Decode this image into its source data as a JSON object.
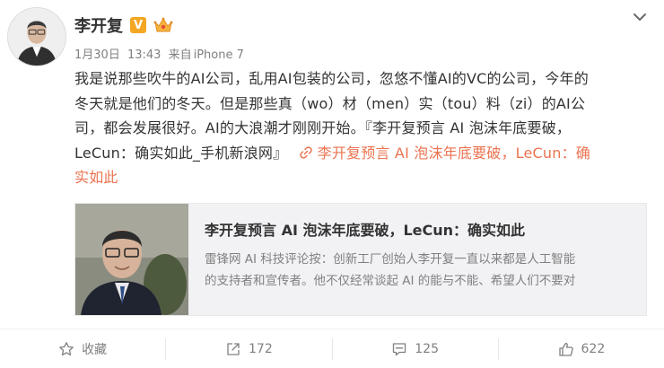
{
  "post": {
    "author": "李开复",
    "verified_badge": "V",
    "meta": {
      "date": "1月30日",
      "time": "13:43",
      "source_prefix": "来自",
      "source": "iPhone 7"
    },
    "content": {
      "line1": "我是说那些吹牛的AI公司，乱用AI包装的公司，忽悠不懂AI的VC的公司，今年的",
      "line2": "冬天就是他们的冬天。但是那些真（wo）材（men）实（tou）料（zi）的AI公",
      "line3": "司，都会发展很好。AI的大浪潮才刚刚开始。『李开复预言 AI 泡沫年底要破，",
      "line4": "LeCun：确实如此_手机新浪网』",
      "link_part1": "李开复预言 AI 泡沫年底要破，LeCun：确",
      "link_part2": "实如此"
    },
    "card": {
      "title": "李开复预言 AI 泡沫年底要破，LeCun：确实如此",
      "desc_line1": "雷锋网 AI 科技评论按：创新工厂创始人李开复一直以来都是人工智能",
      "desc_line2": "的支持者和宣传者。他不仅经常谈起 AI 的能与不能、希望人们不要对"
    },
    "actions": {
      "favorite": "收藏",
      "repost": "172",
      "comment": "125",
      "like": "622"
    },
    "colors": {
      "link": "#eb7350",
      "badge": "#f5a623",
      "muted": "#808080"
    },
    "icons": [
      "chevron-down-icon",
      "link-icon",
      "star-icon",
      "repost-icon",
      "comment-icon",
      "like-icon",
      "crown-icon"
    ]
  }
}
